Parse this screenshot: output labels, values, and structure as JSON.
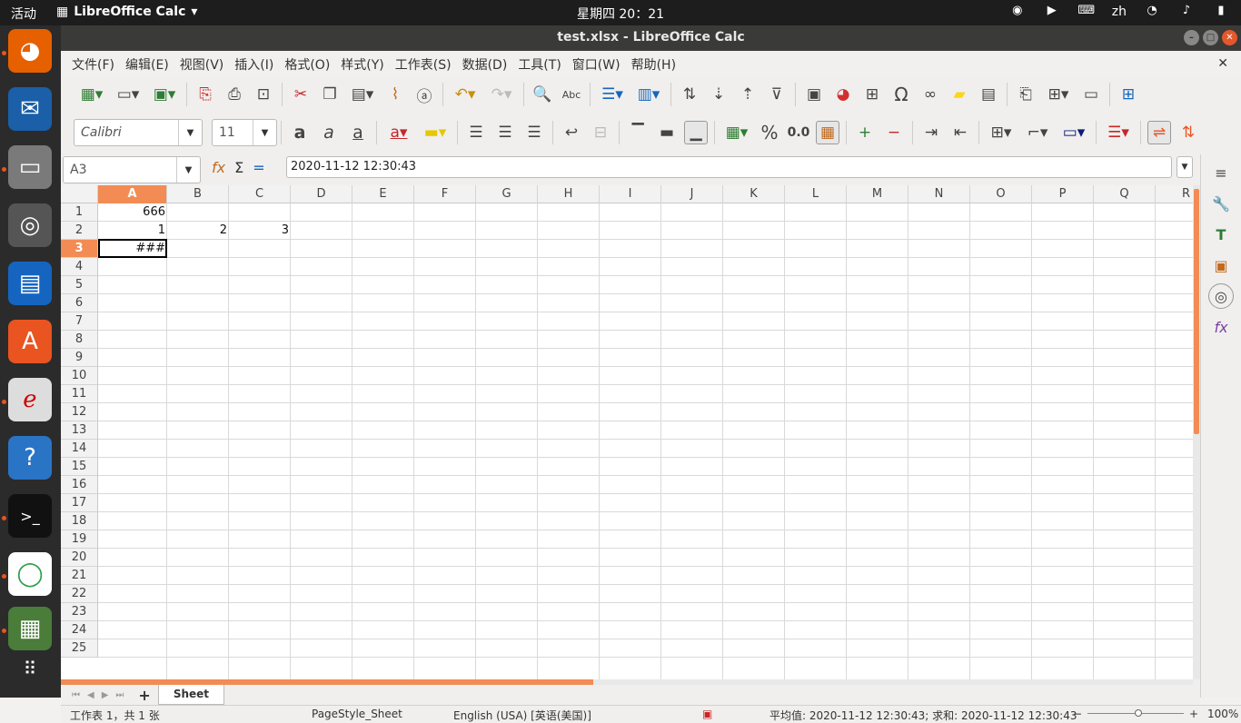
{
  "topbar": {
    "activities": "活动",
    "app_name": "LibreOffice Calc",
    "clock": "星期四 20：21",
    "lang": "zh"
  },
  "window": {
    "title": "test.xlsx - LibreOffice Calc"
  },
  "menu": [
    "文件(F)",
    "编辑(E)",
    "视图(V)",
    "插入(I)",
    "格式(O)",
    "样式(Y)",
    "工作表(S)",
    "数据(D)",
    "工具(T)",
    "窗口(W)",
    "帮助(H)"
  ],
  "format": {
    "font_name": "Calibri",
    "font_size": "11",
    "percent": "%",
    "decimal": "0.0"
  },
  "formula_bar": {
    "name_box": "A3",
    "content": "2020-11-12 12:30:43"
  },
  "columns": [
    "A",
    "B",
    "C",
    "D",
    "E",
    "F",
    "G",
    "H",
    "I",
    "J",
    "K",
    "L",
    "M",
    "N",
    "O",
    "P",
    "Q",
    "R"
  ],
  "rows": [
    "1",
    "2",
    "3",
    "4",
    "5",
    "6",
    "7",
    "8",
    "9",
    "10",
    "11",
    "12",
    "13",
    "14",
    "15",
    "16",
    "17",
    "18",
    "19",
    "20",
    "21",
    "22",
    "23",
    "24",
    "25"
  ],
  "cells": {
    "A1": "666",
    "A2": "1",
    "B2": "2",
    "C2": "3",
    "A3": "###"
  },
  "sheet_tab": "Sheet",
  "status": {
    "sheet_count": "工作表 1，共 1 张",
    "page_style": "PageStyle_Sheet",
    "language": "English (USA) [英语(美国)]",
    "summary": "平均值: 2020-11-12 12:30:43; 求和: 2020-11-12 12:30:43",
    "zoom": "100%"
  },
  "colors": {
    "accent": "#f28c54",
    "titlebar": "#3a3a38",
    "dock": "#2b2b2b"
  }
}
